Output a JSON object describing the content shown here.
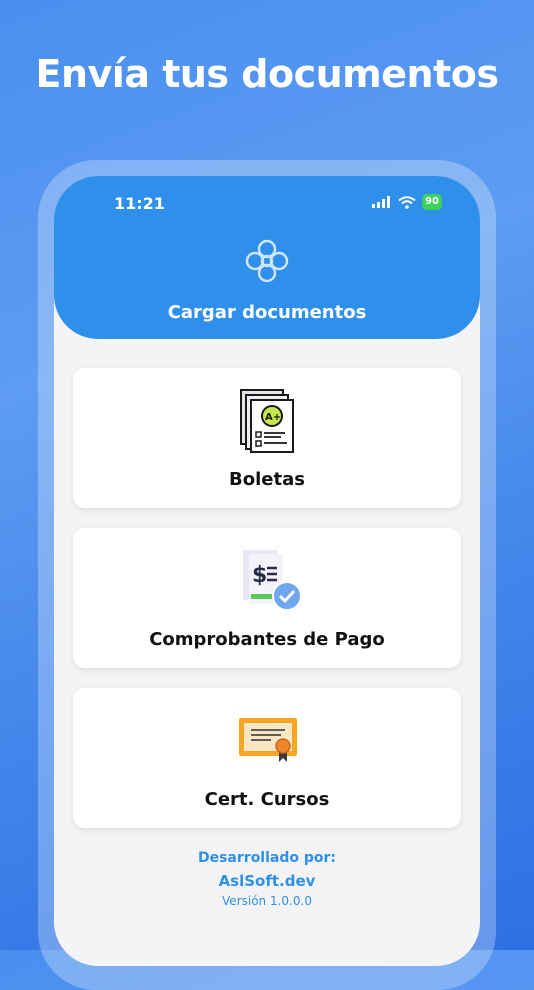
{
  "headline": "Envía tus documentos",
  "status_bar": {
    "time": "11:21",
    "battery": "90"
  },
  "app": {
    "title": "Cargar documentos",
    "logo_icon": "knot-logo-icon"
  },
  "cards": [
    {
      "label": "Boletas",
      "icon": "grades-document-icon"
    },
    {
      "label": "Comprobantes de Pago",
      "icon": "payment-receipt-icon"
    },
    {
      "label": "Cert. Cursos",
      "icon": "certificate-icon"
    }
  ],
  "footer": {
    "developed_by": "Desarrollado por:",
    "developer": "AslSoft.dev",
    "version": "Versión 1.0.0.0"
  },
  "colors": {
    "primary": "#2f90ec",
    "background": "#4a8ff0",
    "battery": "#3bd15b"
  }
}
